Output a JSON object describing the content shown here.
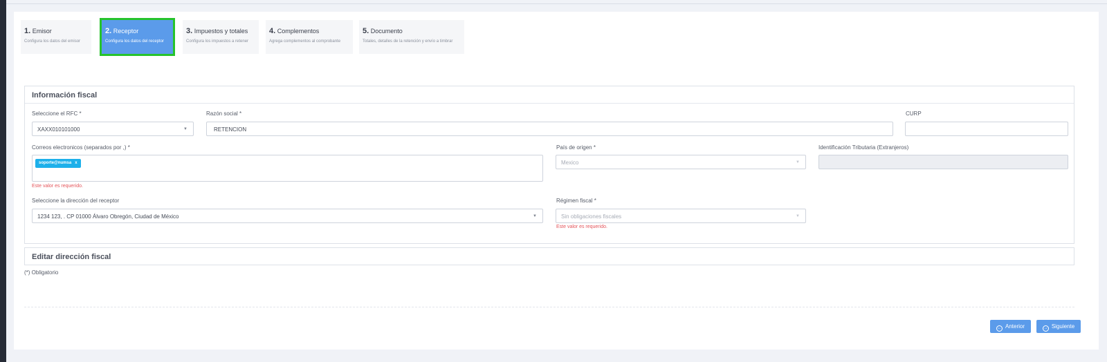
{
  "steps": [
    {
      "num": "1.",
      "title": "Emisor",
      "subtitle": "Configura los datos del emisor",
      "active": false
    },
    {
      "num": "2.",
      "title": "Receptor",
      "subtitle": "Configura los datos del receptor",
      "active": true
    },
    {
      "num": "3.",
      "title": "Impuestos y totales",
      "subtitle": "Configura los impuestos a retener",
      "active": false
    },
    {
      "num": "4.",
      "title": "Complementos",
      "subtitle": "Agrega complementos al comprobante",
      "active": false
    },
    {
      "num": "5.",
      "title": "Documento",
      "subtitle": "Totales, detalles de la retención y envío a timbrar",
      "active": false
    }
  ],
  "fiscal": {
    "heading": "Información fiscal",
    "rfc_label": "Seleccione el RFC *",
    "rfc_value": "XAXX010101000",
    "razon_label": "Razón social *",
    "razon_value": "RETENCION",
    "curp_label": "CURP",
    "curp_value": "",
    "correos_label": "Correos electronicos (separados por ,) *",
    "correo_tag": "soporte@numsa",
    "correo_tag_remove": "x",
    "correos_error": "Este valor es requerido.",
    "pais_label": "País de origen *",
    "pais_value": "Mexico",
    "idtrib_label": "Identificación Tributaria (Extranjeros)",
    "idtrib_value": "",
    "direccion_label": "Seleccione la dirección del receptor",
    "direccion_value": "1234 123, . CP 01000 Álvaro Obregón, Ciudad de México",
    "regimen_label": "Régimen fiscal *",
    "regimen_placeholder": "Sin obligaciones fiscales",
    "regimen_error": "Este valor es requerido."
  },
  "direccion_panel": {
    "heading": "Editar dirección fiscal"
  },
  "footer": {
    "obligatorio": "(*) Obligatorio",
    "anterior_label": "Anterior",
    "siguiente_label": "Siguiente"
  },
  "icons": {
    "anterior": "arrow-left-circle-icon",
    "siguiente": "arrow-right-circle-icon",
    "caret": "caret-down-icon"
  },
  "colors": {
    "accent": "#5b9bea",
    "active_outline": "#26c32b",
    "tag": "#1db0ea",
    "error": "#e4545a"
  }
}
